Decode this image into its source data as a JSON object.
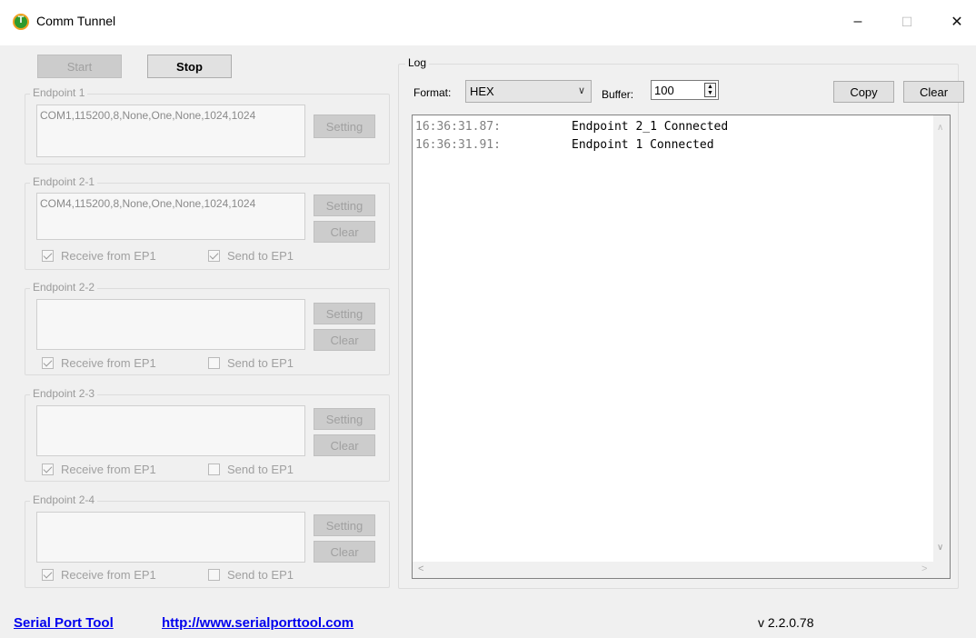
{
  "window": {
    "title": "Comm Tunnel",
    "minimize": "–",
    "maximize": "☐",
    "close": "✕"
  },
  "controls": {
    "start_label": "Start",
    "stop_label": "Stop"
  },
  "endpoints": [
    {
      "title": "Endpoint 1",
      "config": "COM1,115200,8,None,One,None,1024,1024",
      "setting_label": "Setting"
    },
    {
      "title": "Endpoint 2-1",
      "config": "COM4,115200,8,None,One,None,1024,1024",
      "setting_label": "Setting",
      "clear_label": "Clear",
      "receive_label": "Receive from EP1",
      "send_label": "Send to EP1",
      "receive_checked": true,
      "send_checked": true
    },
    {
      "title": "Endpoint 2-2",
      "config": "",
      "setting_label": "Setting",
      "clear_label": "Clear",
      "receive_label": "Receive from EP1",
      "send_label": "Send to EP1",
      "receive_checked": true,
      "send_checked": false
    },
    {
      "title": "Endpoint 2-3",
      "config": "",
      "setting_label": "Setting",
      "clear_label": "Clear",
      "receive_label": "Receive from EP1",
      "send_label": "Send to EP1",
      "receive_checked": true,
      "send_checked": false
    },
    {
      "title": "Endpoint 2-4",
      "config": "",
      "setting_label": "Setting",
      "clear_label": "Clear",
      "receive_label": "Receive from EP1",
      "send_label": "Send to EP1",
      "receive_checked": true,
      "send_checked": false
    }
  ],
  "log": {
    "title": "Log",
    "format_label": "Format:",
    "format_value": "HEX",
    "buffer_label": "Buffer:",
    "buffer_value": "100",
    "copy_label": "Copy",
    "clear_label": "Clear",
    "entries": [
      {
        "time": "16:36:31.87:",
        "message": "Endpoint 2_1 Connected"
      },
      {
        "time": "16:36:31.91:",
        "message": "Endpoint 1 Connected"
      }
    ]
  },
  "footer": {
    "product": "Serial Port Tool",
    "url": "http://www.serialporttool.com",
    "version": "v 2.2.0.78"
  },
  "colors": {
    "link": "#0000ee",
    "disabled_text": "#a0a0a0",
    "log_time": "#808080"
  }
}
